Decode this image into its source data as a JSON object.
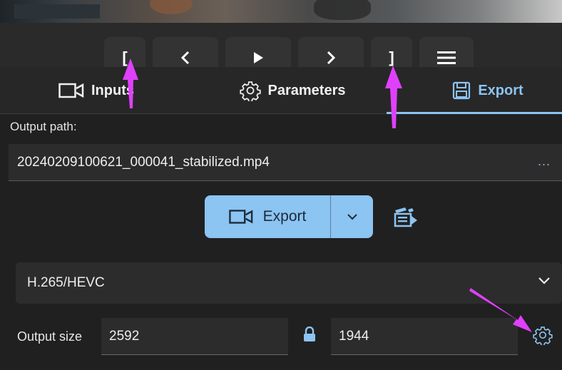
{
  "transport": {
    "mark_in": "[",
    "mark_out": "]",
    "icons": [
      "previous-frame-icon",
      "play-icon",
      "next-frame-icon",
      "menu-icon"
    ]
  },
  "tabs": [
    {
      "label": "Inputs",
      "icon": "video-camera-icon"
    },
    {
      "label": "Parameters",
      "icon": "gear-icon"
    },
    {
      "label": "Export",
      "icon": "floppy-disk-icon",
      "active": true
    }
  ],
  "output": {
    "path_label": "Output path:",
    "path_value": "20240209100621_000041_stabilized.mp4",
    "browse_label": "..."
  },
  "export_button": {
    "label": "Export"
  },
  "codec": {
    "selected": "H.265/HEVC"
  },
  "output_size": {
    "label": "Output size",
    "width": "2592",
    "height": "1944"
  },
  "colors": {
    "accent": "#8cc4f2",
    "annotation_arrow": "#e040fb",
    "background": "#202020"
  }
}
